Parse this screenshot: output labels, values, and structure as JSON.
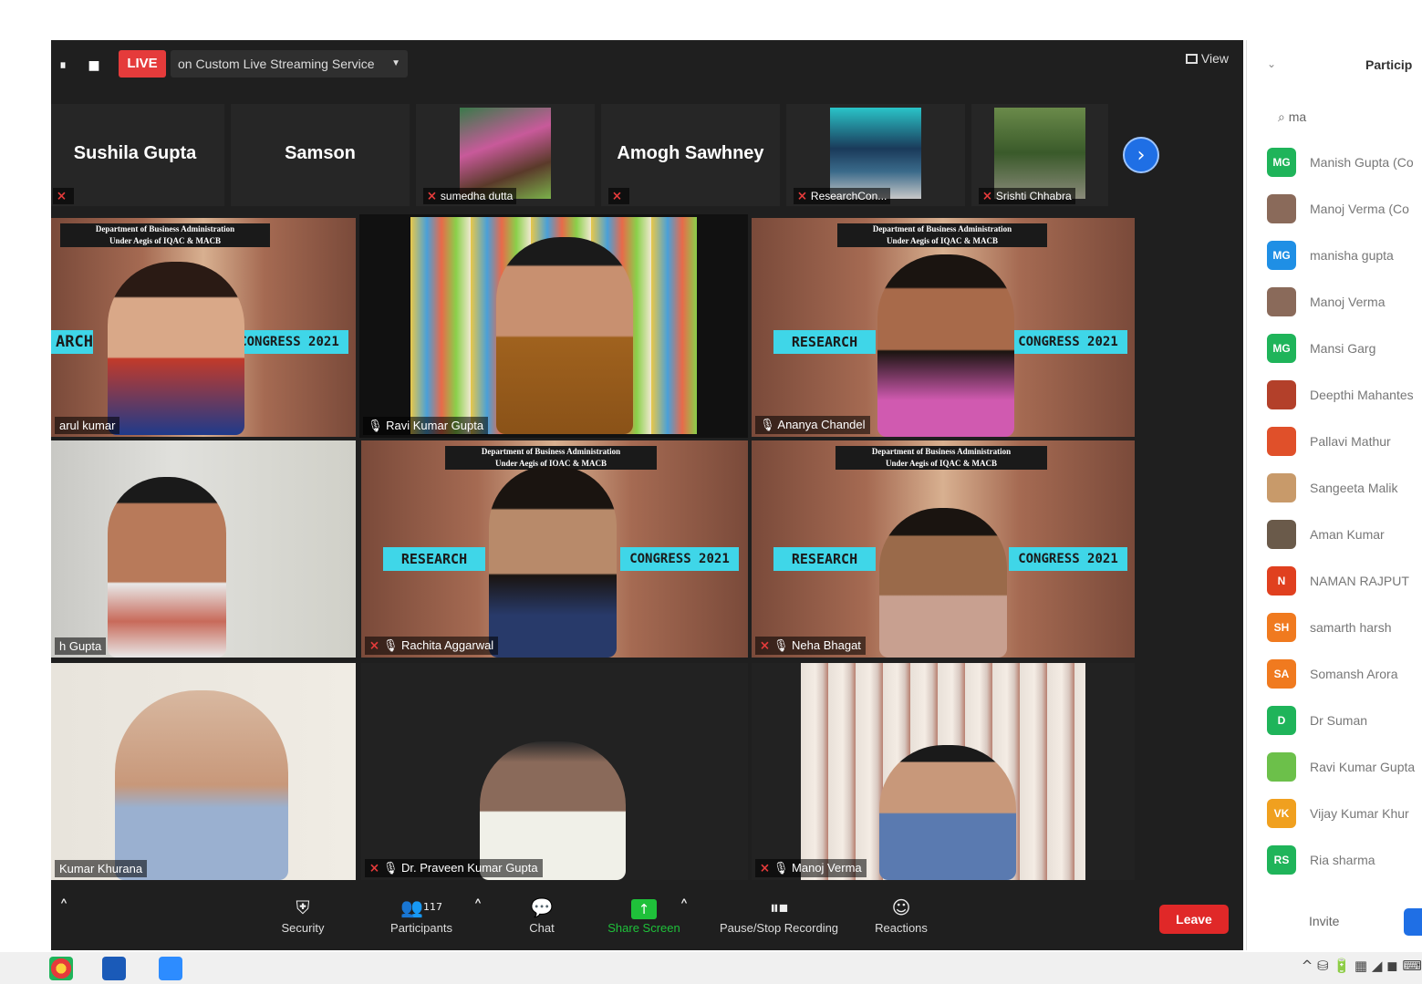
{
  "top_bar": {
    "pause_label": "⏸",
    "stop_label": "■",
    "live_badge": "LIVE",
    "stream_target": "on Custom Live Streaming Service",
    "view_label": "View"
  },
  "filmstrip": [
    {
      "name": "Sushila Gupta",
      "label": ""
    },
    {
      "name": "Samson",
      "label": ""
    },
    {
      "name": "",
      "label": "sumedha dutta"
    },
    {
      "name": "Amogh Sawhney",
      "label": ""
    },
    {
      "name": "",
      "label": "ResearchCon..."
    },
    {
      "name": "",
      "label": "Srishti Chhabra"
    }
  ],
  "banner_colors": {
    "brick": "#8a5a48",
    "cyan": "#3fd6e8",
    "sky": "#e8e8ea"
  },
  "video_tiles": [
    {
      "name": "arul kumar",
      "muted": false
    },
    {
      "name": "Ravi Kumar Gupta",
      "muted": false
    },
    {
      "name": "Ananya Chandel",
      "muted": false
    },
    {
      "name": "h Gupta",
      "muted": false
    },
    {
      "name": "Rachita Aggarwal",
      "muted": true
    },
    {
      "name": "Neha Bhagat",
      "muted": true
    },
    {
      "name": "Kumar Khurana",
      "muted": false
    },
    {
      "name": "Dr. Praveen Kumar Gupta",
      "muted": true
    },
    {
      "name": "Manoj Verma",
      "muted": true
    }
  ],
  "banner": {
    "line1": "Department of Business Administration",
    "line2": "Under Aegis of IQAC & MACB",
    "research": "RESEARCH",
    "congress": "CONGRESS 2021"
  },
  "toolbar": {
    "security": "Security",
    "participants": "Participants",
    "participants_count": "117",
    "chat": "Chat",
    "share_screen": "Share Screen",
    "pause_stop_recording": "Pause/Stop Recording",
    "reactions": "Reactions",
    "leave": "Leave"
  },
  "participants_panel": {
    "title": "Particip",
    "search_query": "ma",
    "invite": "Invite",
    "items": [
      {
        "initials": "MG",
        "name": "Manish Gupta (Co",
        "color": "#1fb45a"
      },
      {
        "initials": "",
        "name": "Manoj Verma (Co",
        "color": "#8a6a5a"
      },
      {
        "initials": "MG",
        "name": "manisha gupta",
        "color": "#1f8fe5"
      },
      {
        "initials": "",
        "name": "Manoj Verma",
        "color": "#8a6a5a"
      },
      {
        "initials": "MG",
        "name": "Mansi Garg",
        "color": "#1fb45a"
      },
      {
        "initials": "",
        "name": "Deepthi Mahantes",
        "color": "#b3402a"
      },
      {
        "initials": "",
        "name": "Pallavi Mathur",
        "color": "#e0502a"
      },
      {
        "initials": "",
        "name": "Sangeeta Malik",
        "color": "#c89a6a"
      },
      {
        "initials": "",
        "name": "Aman Kumar",
        "color": "#6a5a4a"
      },
      {
        "initials": "N",
        "name": "NAMAN RAJPUT",
        "color": "#e0401f"
      },
      {
        "initials": "SH",
        "name": "samarth harsh",
        "color": "#f07a1f"
      },
      {
        "initials": "SA",
        "name": "Somansh Arora",
        "color": "#f07a1f"
      },
      {
        "initials": "D",
        "name": "Dr Suman",
        "color": "#1fb45a"
      },
      {
        "initials": "",
        "name": "Ravi Kumar Gupta",
        "color": "#6cc04a"
      },
      {
        "initials": "VK",
        "name": "Vijay Kumar Khur",
        "color": "#f0a01f"
      },
      {
        "initials": "RS",
        "name": "Ria sharma",
        "color": "#1fb45a"
      }
    ]
  },
  "taskbar": {
    "tray_icons": "^ ⛁ 🔋 ▦ ◢ ◼ ⌨"
  }
}
